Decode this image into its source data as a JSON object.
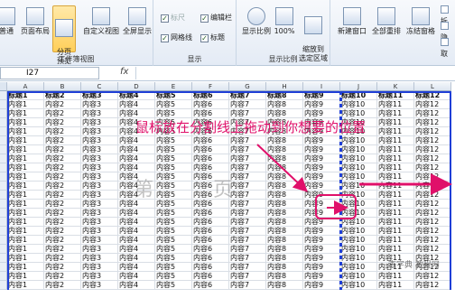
{
  "ribbon": {
    "view_group": {
      "label": "工作簿视图",
      "buttons": [
        {
          "label": "普通",
          "selected": false
        },
        {
          "label": "页面布局",
          "selected": false
        },
        {
          "label": "分页\n预览",
          "selected": true
        },
        {
          "label": "自定义视图",
          "selected": false
        },
        {
          "label": "全屏显示",
          "selected": false
        }
      ]
    },
    "show_group": {
      "label": "显示",
      "items": [
        {
          "label": "标尺",
          "checked": true,
          "disabled": true
        },
        {
          "label": "编辑栏",
          "checked": true,
          "disabled": false
        },
        {
          "label": "网格线",
          "checked": true,
          "disabled": false
        },
        {
          "label": "标题",
          "checked": true,
          "disabled": false
        }
      ]
    },
    "zoom_group": {
      "label": "显示比例",
      "buttons": [
        {
          "label": "显示比例"
        },
        {
          "label": "100%"
        },
        {
          "label": "缩放到\n选定区域"
        }
      ]
    },
    "window_group": {
      "buttons": [
        {
          "label": "新建窗口"
        },
        {
          "label": "全部重排"
        },
        {
          "label": "冻结窗格"
        }
      ],
      "partial_items": [
        "拆",
        "隐",
        "取"
      ]
    }
  },
  "formula_bar": {
    "name_box": "I27",
    "fx": "fx",
    "formula": ""
  },
  "sheet": {
    "columns": [
      "A",
      "B",
      "C",
      "D",
      "E",
      "F",
      "G",
      "H",
      "I",
      "J",
      "K",
      "L"
    ],
    "header_row": [
      "标题1",
      "标题2",
      "标题3",
      "标题4",
      "标题5",
      "标题6",
      "标题7",
      "标题8",
      "标题9",
      "标题10",
      "标题11",
      "标题12"
    ],
    "body_cells": [
      "内容1",
      "内容2",
      "内容3",
      "内容4",
      "内容5",
      "内容6",
      "内容7",
      "内容8",
      "内容9",
      "内容10",
      "内容11",
      "内容12"
    ],
    "visible_body_rows": 21
  },
  "annotation": {
    "text": "鼠标放在分割线上拖动到你想要的位置",
    "color": "#e0106a"
  },
  "watermarks": {
    "page_left": "第",
    "page_right": "页",
    "cell_mark": "9",
    "site": "查字典 教程网"
  },
  "colors": {
    "page_break": "#1f3fd6",
    "annotation_pink": "#e0106a",
    "selected_button": "#ffcf5a"
  }
}
